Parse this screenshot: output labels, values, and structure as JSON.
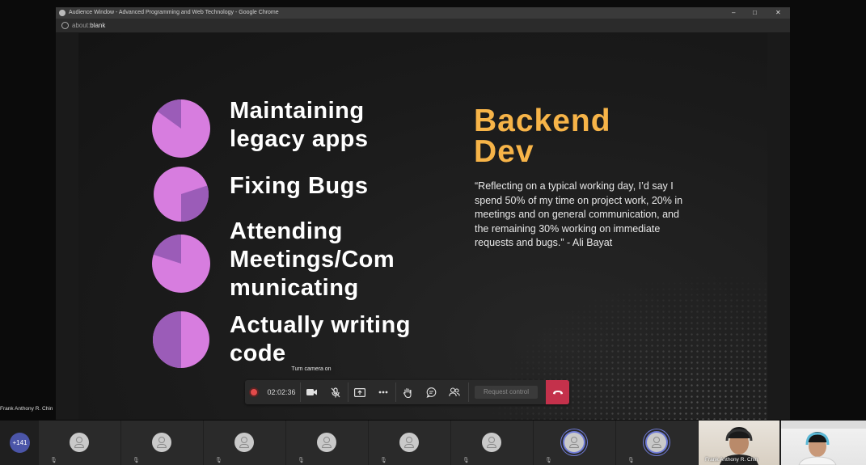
{
  "window": {
    "title": "Audience Window - Advanced Programming and Web Technology - Google Chrome",
    "controls": {
      "minimize": "–",
      "maximize": "□",
      "close": "✕"
    }
  },
  "address_bar": {
    "prefix": "about:",
    "host": "blank"
  },
  "slide": {
    "items": [
      {
        "label": "Maintaining\nlegacy apps",
        "fraction": 0.15
      },
      {
        "label": "Fixing Bugs",
        "fraction": 0.3
      },
      {
        "label": "Attending\nMeetings/Com\nmunicating",
        "fraction": 0.2
      },
      {
        "label": "Actually writing\ncode",
        "fraction": 0.5
      }
    ],
    "heading": "Backend\nDev",
    "quote": "“Reflecting on a typical working day, I’d say I spend 50% of my time on project work, 20% in meetings and on general communication, and the remaining 30% working on immediate requests and bugs.” - Ali Bayat",
    "colors": {
      "pie_main": "#d77ddf",
      "pie_slice": "#9b5cb8",
      "heading": "#f7b448"
    }
  },
  "tooltip": "Turn camera on",
  "meeting_toolbar": {
    "timer": "02:02:36",
    "request_control": "Request control",
    "icons": [
      "record-icon",
      "camera-icon",
      "mic-off-icon",
      "share-screen-icon",
      "more-icon",
      "raise-hand-icon",
      "chat-icon",
      "people-icon",
      "hang-up-icon"
    ],
    "hangup_color": "#c4314b"
  },
  "presenter_label": "Frank Anthony R. Chin",
  "participants": {
    "overflow": "+141",
    "video_tile_label": "Frank Anthony R. Chin",
    "accent": "#4b55a8"
  }
}
